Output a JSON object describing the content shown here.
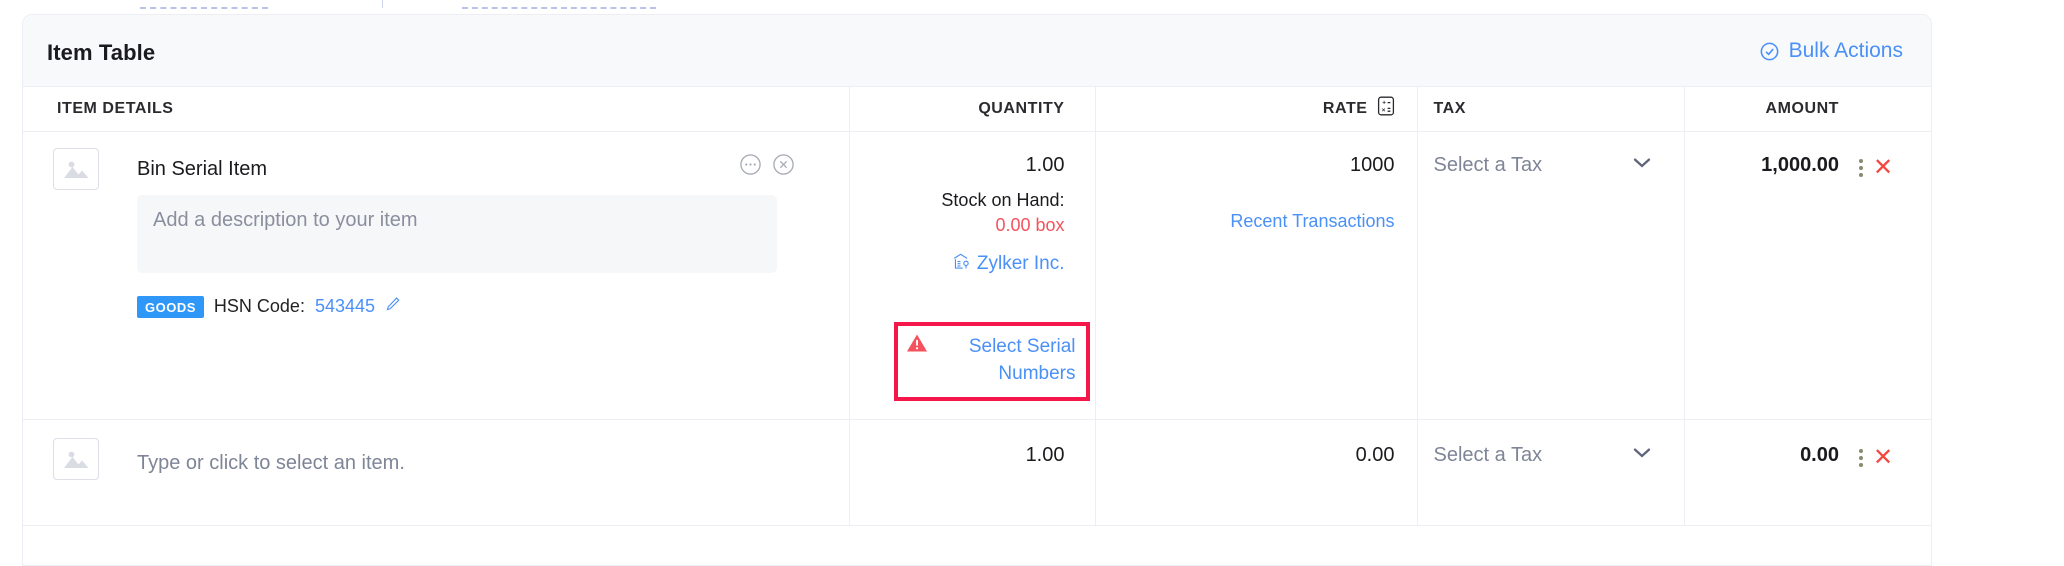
{
  "card": {
    "title": "Item Table",
    "bulk_actions_label": "Bulk Actions",
    "bulk_actions_icon": "check-circle-icon",
    "accent_blue": "#4a90f7",
    "badge_blue": "#2f97f7",
    "danger_red": "#f4525e",
    "highlight_red": "#f5174b",
    "header_bg": "#f8f9fb"
  },
  "columns": {
    "item_details": "ITEM DETAILS",
    "quantity": "QUANTITY",
    "rate": "RATE",
    "rate_icon": "calculator-icon",
    "tax": "TAX",
    "amount": "AMOUNT"
  },
  "rows": [
    {
      "drag_handle_icon": "drag-dots-icon",
      "thumbnail_icon": "image-placeholder-icon",
      "name": "Bin Serial Item",
      "more_icon": "ellipsis-circle-icon",
      "remove_icon": "close-circle-icon",
      "description_placeholder": "Add a description to your item",
      "description_value": "",
      "badge": "GOODS",
      "hsn_label": "HSN Code:",
      "hsn_value": "543445",
      "hsn_edit_icon": "pencil-icon",
      "quantity": "1.00",
      "stock_label": "Stock on Hand:",
      "stock_value": "0.00 box",
      "warehouse_icon": "warehouse-location-icon",
      "warehouse_name": "Zylker Inc.",
      "serial_warning_icon": "warning-triangle-icon",
      "serial_link": "Select Serial Numbers",
      "rate": "1000",
      "recent_transactions": "Recent Transactions",
      "tax_placeholder": "Select a Tax",
      "tax_chevron_icon": "chevron-down-icon",
      "amount": "1,000.00",
      "kebab_icon": "vertical-dots-icon",
      "delete_icon": "x-icon"
    },
    {
      "drag_handle_icon": "drag-dots-icon",
      "thumbnail_icon": "image-placeholder-icon",
      "name_placeholder": "Type or click to select an item.",
      "quantity": "1.00",
      "rate": "0.00",
      "tax_placeholder": "Select a Tax",
      "tax_chevron_icon": "chevron-down-icon",
      "amount": "0.00",
      "kebab_icon": "vertical-dots-icon",
      "delete_icon": "x-icon"
    }
  ]
}
